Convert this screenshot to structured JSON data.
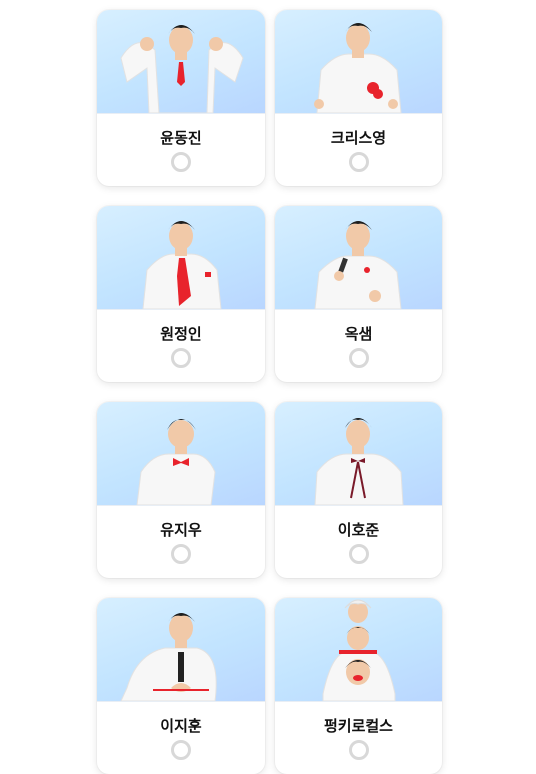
{
  "accent_color": "#e8232c",
  "candidates": [
    {
      "name": "윤동진",
      "selected": false
    },
    {
      "name": "크리스영",
      "selected": false
    },
    {
      "name": "원정인",
      "selected": false
    },
    {
      "name": "옥샘",
      "selected": false
    },
    {
      "name": "유지우",
      "selected": false
    },
    {
      "name": "이호준",
      "selected": false
    },
    {
      "name": "이지훈",
      "selected": false
    },
    {
      "name": "펑키로컬스",
      "selected": false
    }
  ]
}
